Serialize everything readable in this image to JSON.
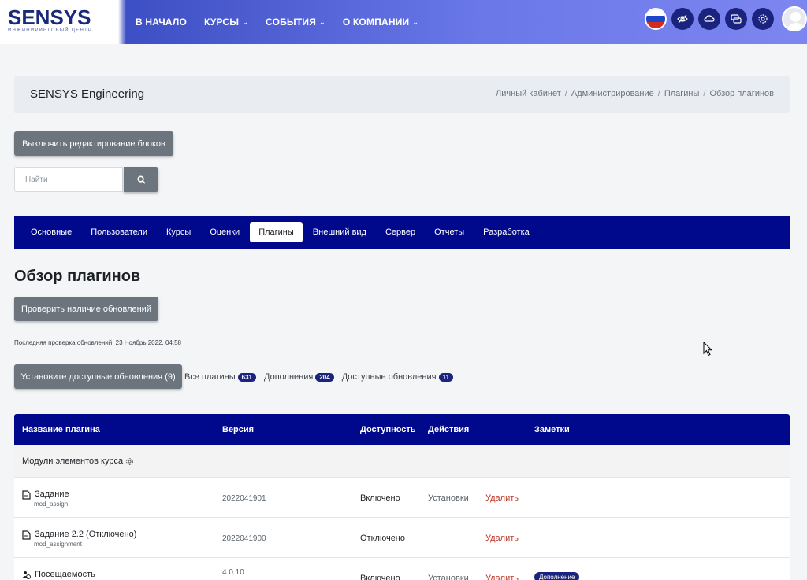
{
  "brand": {
    "name": "SENSYS",
    "tagline": "ИНЖИНИРИНГОВЫЙ ЦЕНТР"
  },
  "nav": {
    "items": [
      {
        "label": "В НАЧАЛО",
        "dropdown": false
      },
      {
        "label": "КУРСЫ",
        "dropdown": true
      },
      {
        "label": "СОБЫТИЯ",
        "dropdown": true
      },
      {
        "label": "О КОМПАНИИ",
        "dropdown": true
      }
    ],
    "icons": [
      "russia-flag-icon",
      "eye-slash-icon",
      "cloud-icon",
      "chat-icon",
      "gear-icon",
      "avatar"
    ]
  },
  "header": {
    "site_title": "SENSYS Engineering",
    "breadcrumb": [
      "Личный кабинет",
      "Администрирование",
      "Плагины",
      "Обзор плагинов"
    ]
  },
  "toggle_edit_label": "Выключить редактирование блоков",
  "search": {
    "placeholder": "Найти"
  },
  "admin_tabs": [
    "Основные",
    "Пользователи",
    "Курсы",
    "Оценки",
    "Плагины",
    "Внешний вид",
    "Сервер",
    "Отчеты",
    "Разработка"
  ],
  "admin_tabs_active": "Плагины",
  "page_title": "Обзор плагинов",
  "check_updates_label": "Проверить наличие обновлений",
  "last_check": "Последняя проверка обновлений: 23 Ноябрь 2022, 04:58",
  "install_updates_label": "Установите доступные обновления (9)",
  "filters": [
    {
      "label": "Все плагины",
      "count": "631"
    },
    {
      "label": "Дополнения",
      "count": "204"
    },
    {
      "label": "Доступные обновления",
      "count": "11"
    }
  ],
  "table": {
    "headers": {
      "name": "Название плагина",
      "version": "Версия",
      "availability": "Доступность",
      "actions": "Действия",
      "notes": "Заметки"
    },
    "group": "Модули элементов курса",
    "rows": [
      {
        "name": "Задание",
        "code": "mod_assign",
        "version": "2022041901",
        "status": "Включено",
        "settings": "Установки",
        "delete": "Удалить",
        "note": ""
      },
      {
        "name": "Задание 2.2 (Отключено)",
        "code": "mod_assignment",
        "version": "2022041900",
        "status": "Отключено",
        "settings": "",
        "delete": "Удалить",
        "note": ""
      },
      {
        "name": "Посещаемость",
        "code": "",
        "version": "4.0.10",
        "status": "Включено",
        "settings": "Установки",
        "delete": "Удалить",
        "note": "Дополнение"
      }
    ]
  },
  "colors": {
    "primary": "#00098c",
    "accent_dark": "#1a237e",
    "button_grey": "#6c757d",
    "delete_red": "#c0392b"
  }
}
